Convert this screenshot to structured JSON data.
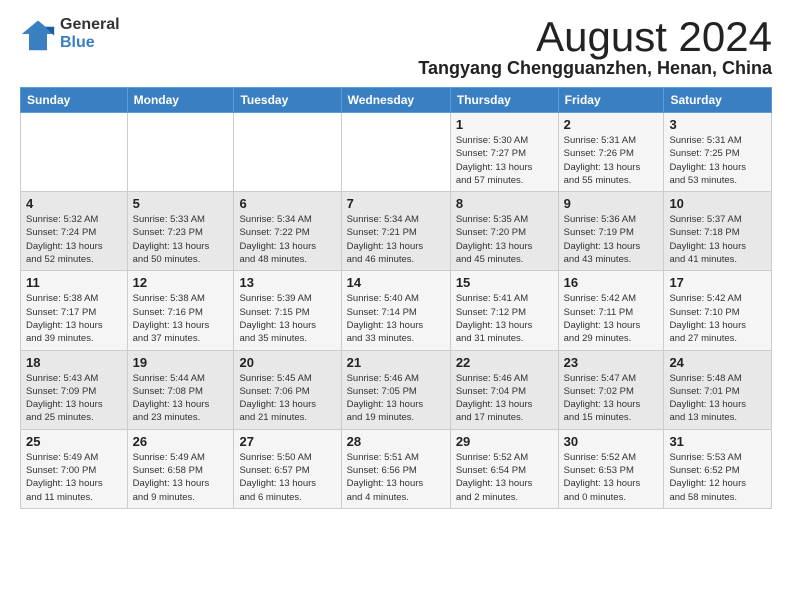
{
  "logo": {
    "general": "General",
    "blue": "Blue"
  },
  "title": {
    "month": "August 2024",
    "location": "Tangyang Chengguanzhen, Henan, China"
  },
  "weekdays": [
    "Sunday",
    "Monday",
    "Tuesday",
    "Wednesday",
    "Thursday",
    "Friday",
    "Saturday"
  ],
  "weeks": [
    [
      {
        "day": "",
        "info": ""
      },
      {
        "day": "",
        "info": ""
      },
      {
        "day": "",
        "info": ""
      },
      {
        "day": "",
        "info": ""
      },
      {
        "day": "1",
        "info": "Sunrise: 5:30 AM\nSunset: 7:27 PM\nDaylight: 13 hours\nand 57 minutes."
      },
      {
        "day": "2",
        "info": "Sunrise: 5:31 AM\nSunset: 7:26 PM\nDaylight: 13 hours\nand 55 minutes."
      },
      {
        "day": "3",
        "info": "Sunrise: 5:31 AM\nSunset: 7:25 PM\nDaylight: 13 hours\nand 53 minutes."
      }
    ],
    [
      {
        "day": "4",
        "info": "Sunrise: 5:32 AM\nSunset: 7:24 PM\nDaylight: 13 hours\nand 52 minutes."
      },
      {
        "day": "5",
        "info": "Sunrise: 5:33 AM\nSunset: 7:23 PM\nDaylight: 13 hours\nand 50 minutes."
      },
      {
        "day": "6",
        "info": "Sunrise: 5:34 AM\nSunset: 7:22 PM\nDaylight: 13 hours\nand 48 minutes."
      },
      {
        "day": "7",
        "info": "Sunrise: 5:34 AM\nSunset: 7:21 PM\nDaylight: 13 hours\nand 46 minutes."
      },
      {
        "day": "8",
        "info": "Sunrise: 5:35 AM\nSunset: 7:20 PM\nDaylight: 13 hours\nand 45 minutes."
      },
      {
        "day": "9",
        "info": "Sunrise: 5:36 AM\nSunset: 7:19 PM\nDaylight: 13 hours\nand 43 minutes."
      },
      {
        "day": "10",
        "info": "Sunrise: 5:37 AM\nSunset: 7:18 PM\nDaylight: 13 hours\nand 41 minutes."
      }
    ],
    [
      {
        "day": "11",
        "info": "Sunrise: 5:38 AM\nSunset: 7:17 PM\nDaylight: 13 hours\nand 39 minutes."
      },
      {
        "day": "12",
        "info": "Sunrise: 5:38 AM\nSunset: 7:16 PM\nDaylight: 13 hours\nand 37 minutes."
      },
      {
        "day": "13",
        "info": "Sunrise: 5:39 AM\nSunset: 7:15 PM\nDaylight: 13 hours\nand 35 minutes."
      },
      {
        "day": "14",
        "info": "Sunrise: 5:40 AM\nSunset: 7:14 PM\nDaylight: 13 hours\nand 33 minutes."
      },
      {
        "day": "15",
        "info": "Sunrise: 5:41 AM\nSunset: 7:12 PM\nDaylight: 13 hours\nand 31 minutes."
      },
      {
        "day": "16",
        "info": "Sunrise: 5:42 AM\nSunset: 7:11 PM\nDaylight: 13 hours\nand 29 minutes."
      },
      {
        "day": "17",
        "info": "Sunrise: 5:42 AM\nSunset: 7:10 PM\nDaylight: 13 hours\nand 27 minutes."
      }
    ],
    [
      {
        "day": "18",
        "info": "Sunrise: 5:43 AM\nSunset: 7:09 PM\nDaylight: 13 hours\nand 25 minutes."
      },
      {
        "day": "19",
        "info": "Sunrise: 5:44 AM\nSunset: 7:08 PM\nDaylight: 13 hours\nand 23 minutes."
      },
      {
        "day": "20",
        "info": "Sunrise: 5:45 AM\nSunset: 7:06 PM\nDaylight: 13 hours\nand 21 minutes."
      },
      {
        "day": "21",
        "info": "Sunrise: 5:46 AM\nSunset: 7:05 PM\nDaylight: 13 hours\nand 19 minutes."
      },
      {
        "day": "22",
        "info": "Sunrise: 5:46 AM\nSunset: 7:04 PM\nDaylight: 13 hours\nand 17 minutes."
      },
      {
        "day": "23",
        "info": "Sunrise: 5:47 AM\nSunset: 7:02 PM\nDaylight: 13 hours\nand 15 minutes."
      },
      {
        "day": "24",
        "info": "Sunrise: 5:48 AM\nSunset: 7:01 PM\nDaylight: 13 hours\nand 13 minutes."
      }
    ],
    [
      {
        "day": "25",
        "info": "Sunrise: 5:49 AM\nSunset: 7:00 PM\nDaylight: 13 hours\nand 11 minutes."
      },
      {
        "day": "26",
        "info": "Sunrise: 5:49 AM\nSunset: 6:58 PM\nDaylight: 13 hours\nand 9 minutes."
      },
      {
        "day": "27",
        "info": "Sunrise: 5:50 AM\nSunset: 6:57 PM\nDaylight: 13 hours\nand 6 minutes."
      },
      {
        "day": "28",
        "info": "Sunrise: 5:51 AM\nSunset: 6:56 PM\nDaylight: 13 hours\nand 4 minutes."
      },
      {
        "day": "29",
        "info": "Sunrise: 5:52 AM\nSunset: 6:54 PM\nDaylight: 13 hours\nand 2 minutes."
      },
      {
        "day": "30",
        "info": "Sunrise: 5:52 AM\nSunset: 6:53 PM\nDaylight: 13 hours\nand 0 minutes."
      },
      {
        "day": "31",
        "info": "Sunrise: 5:53 AM\nSunset: 6:52 PM\nDaylight: 12 hours\nand 58 minutes."
      }
    ]
  ]
}
